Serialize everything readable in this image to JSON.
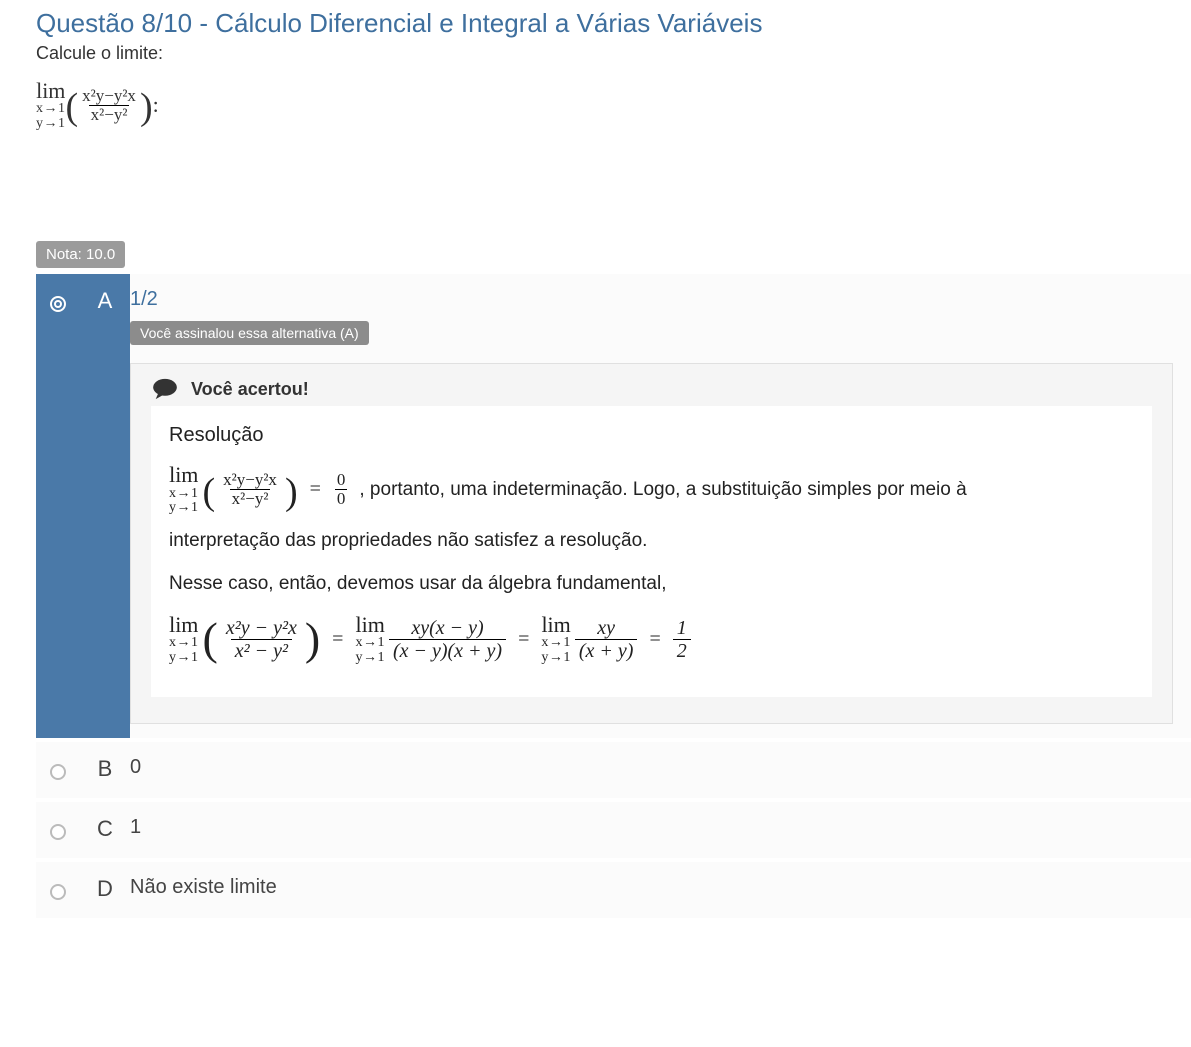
{
  "question": {
    "title": "Questão 8/10 - Cálculo Diferencial e Integral a Várias Variáveis",
    "prompt": "Calcule o limite:",
    "limit": {
      "lim_label": "lim",
      "sub1": "x→1",
      "sub2": "y→1",
      "numerator": "x²y−y²x",
      "denominator": "x²−y²",
      "trailing": ":"
    }
  },
  "score": {
    "label": "Nota: 10.0"
  },
  "alternatives": [
    {
      "letter": "A",
      "answer": "1/2",
      "selected": true,
      "marked_label": "Você assinalou essa alternativa (A)",
      "feedback": {
        "correct_label": "Você acertou!",
        "section_title": "Resolução",
        "step1": {
          "num": "x²y−y²x",
          "den": "x²−y²",
          "eq_num": "0",
          "eq_den": "0",
          "after": ", portanto, uma indeterminação. Logo, a substituição simples por meio à"
        },
        "line2": "interpretação das propriedades não satisfez a resolução.",
        "line3": "Nesse caso, então, devemos usar da álgebra fundamental,",
        "step2": {
          "p1_num": "x²y − y²x",
          "p1_den": "x² − y²",
          "p2_num": "xy(x − y)",
          "p2_den": "(x − y)(x + y)",
          "p3_num": "xy",
          "p3_den": "(x + y)",
          "result_num": "1",
          "result_den": "2"
        }
      }
    },
    {
      "letter": "B",
      "answer": "0",
      "selected": false
    },
    {
      "letter": "C",
      "answer": "1",
      "selected": false
    },
    {
      "letter": "D",
      "answer": "Não existe limite",
      "selected": false
    }
  ]
}
